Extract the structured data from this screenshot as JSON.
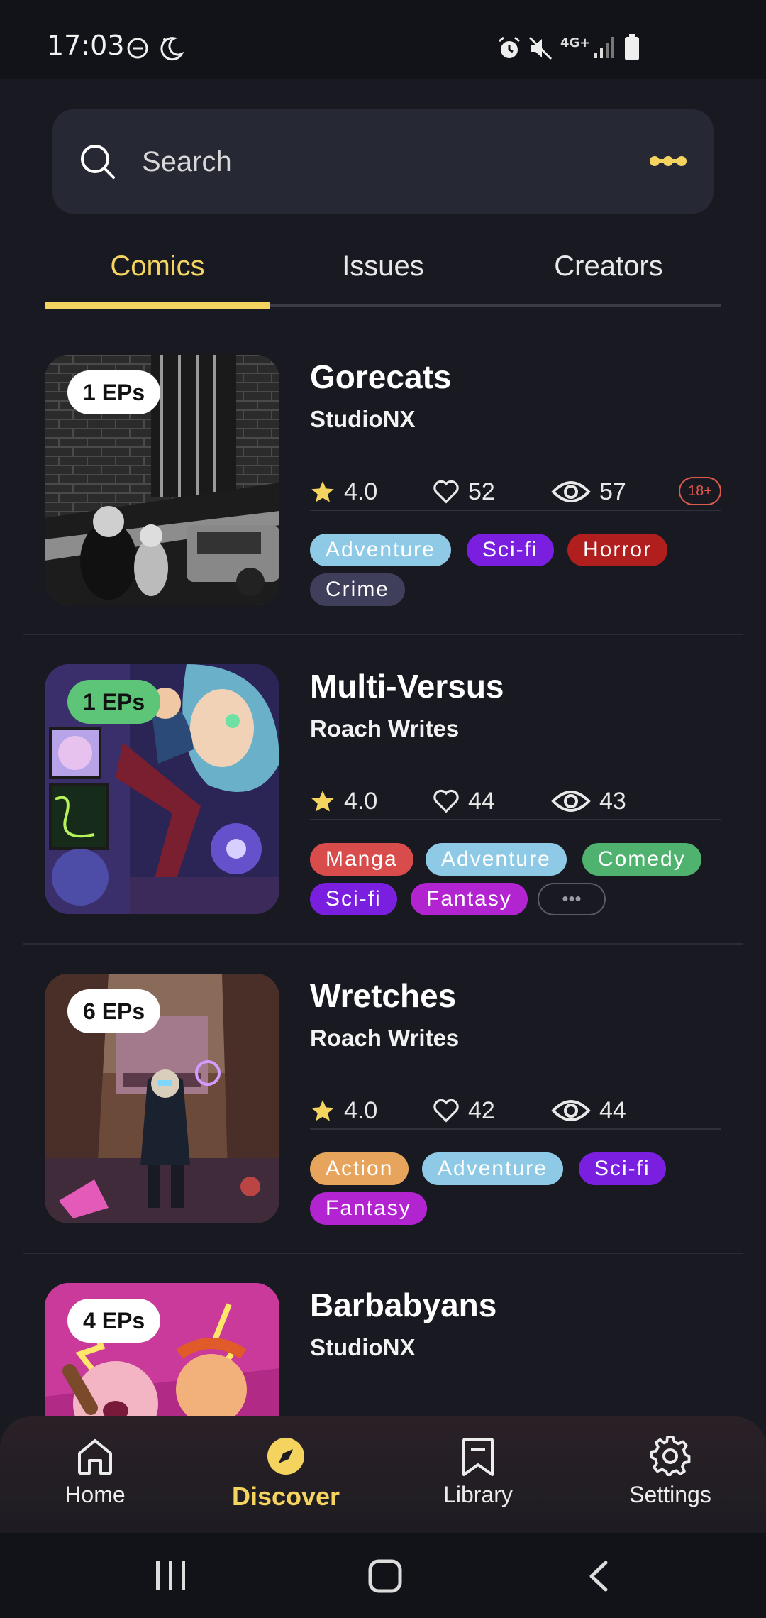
{
  "status_bar": {
    "time": "17:03",
    "network": "4G+",
    "icons": [
      "do-not-disturb-icon",
      "night-mode-icon",
      "alarm-icon",
      "mute-icon",
      "network-icon",
      "signal-icon",
      "battery-icon"
    ]
  },
  "search": {
    "placeholder": "Search"
  },
  "tabs": [
    {
      "label": "Comics",
      "active": true
    },
    {
      "label": "Issues",
      "active": false
    },
    {
      "label": "Creators",
      "active": false
    }
  ],
  "colors": {
    "accent": "#f4d35e",
    "background": "#191a21",
    "surface": "#262833"
  },
  "comics": [
    {
      "title": "Gorecats",
      "creator": "StudioNX",
      "episodes": "1 EPs",
      "rating": "4.0",
      "likes": "52",
      "views": "57",
      "age_rating": "18+",
      "tags": [
        {
          "label": "Adventure",
          "color": "#8ec9e6"
        },
        {
          "label": "Sci-fi",
          "color": "#7a1fe0"
        },
        {
          "label": "Horror",
          "color": "#b01e1e"
        },
        {
          "label": "Crime",
          "color": "#3f3f5c"
        }
      ]
    },
    {
      "title": "Multi-Versus",
      "creator": "Roach Writes",
      "episodes": "1 EPs",
      "rating": "4.0",
      "likes": "44",
      "views": "43",
      "tags": [
        {
          "label": "Manga",
          "color": "#d84c4c"
        },
        {
          "label": "Adventure",
          "color": "#8ec9e6"
        },
        {
          "label": "Comedy",
          "color": "#4fb36f"
        },
        {
          "label": "Sci-fi",
          "color": "#7a1fe0"
        },
        {
          "label": "Fantasy",
          "color": "#b324d1"
        }
      ],
      "more_tags": "•••"
    },
    {
      "title": "Wretches",
      "creator": "Roach Writes",
      "episodes": "6 EPs",
      "rating": "4.0",
      "likes": "42",
      "views": "44",
      "tags": [
        {
          "label": "Action",
          "color": "#e6a45c"
        },
        {
          "label": "Adventure",
          "color": "#8ec9e6"
        },
        {
          "label": "Sci-fi",
          "color": "#7a1fe0"
        },
        {
          "label": "Fantasy",
          "color": "#b324d1"
        }
      ]
    },
    {
      "title": "Barbabyans",
      "creator": "StudioNX",
      "episodes": "4 EPs"
    }
  ],
  "bottom_nav": [
    {
      "label": "Home",
      "icon": "home-icon"
    },
    {
      "label": "Discover",
      "icon": "compass-icon",
      "active": true
    },
    {
      "label": "Library",
      "icon": "bookmark-icon"
    },
    {
      "label": "Settings",
      "icon": "gear-icon"
    }
  ]
}
